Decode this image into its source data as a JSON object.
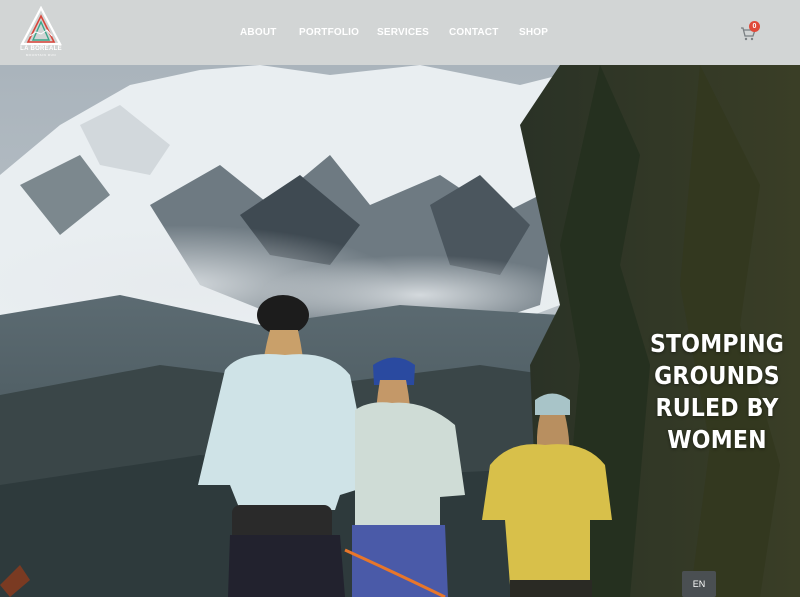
{
  "brand": {
    "name": "LA BOREALE",
    "tagline": "MOUNTAIN RUN"
  },
  "nav": {
    "items": [
      "ABOUT",
      "PORTFOLIO",
      "SERVICES",
      "CONTACT",
      "SHOP"
    ]
  },
  "cart": {
    "count": "0",
    "icon": "cart-icon"
  },
  "hero": {
    "headline_lines": [
      "STOMPING",
      "GROUNDS",
      "RULED BY",
      "WOMEN"
    ]
  },
  "language": {
    "current": "EN"
  },
  "colors": {
    "header_bg": "#d2d5d5",
    "accent_badge": "#e04a3a",
    "logo_red": "#d9453a",
    "logo_green": "#3aa68a"
  }
}
